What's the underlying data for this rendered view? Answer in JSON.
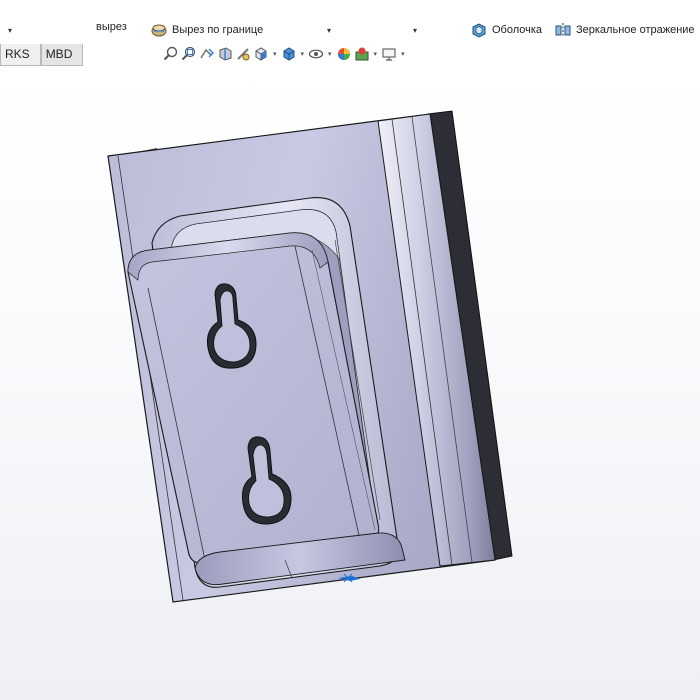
{
  "ribbon": {
    "cut_label": "вырез",
    "boundary_cut_label": "Вырез по границе",
    "shell_label": "Оболочка",
    "mirror_label": "Зеркальное отражение",
    "dropdown_caret": "▾"
  },
  "tabs": [
    {
      "label": "RKS"
    },
    {
      "label": "MBD"
    }
  ],
  "heads_up_toolbar": {
    "icons": [
      "zoom-to-fit-icon",
      "zoom-to-area-icon",
      "previous-view-icon",
      "section-view-icon",
      "dynamic-annotation-icon",
      "view-orientation-icon",
      "display-style-icon",
      "hide-show-items-icon",
      "edit-appearance-icon",
      "apply-scene-icon",
      "view-settings-icon"
    ]
  },
  "colors": {
    "accent": "#1e6fd0",
    "model_face_light": "#e4e5f3",
    "model_face_mid": "#b2b2cf",
    "model_face_dark": "#6d6d88",
    "model_edge": "#1a1a1a",
    "model_side_dark": "#2f2f38"
  }
}
